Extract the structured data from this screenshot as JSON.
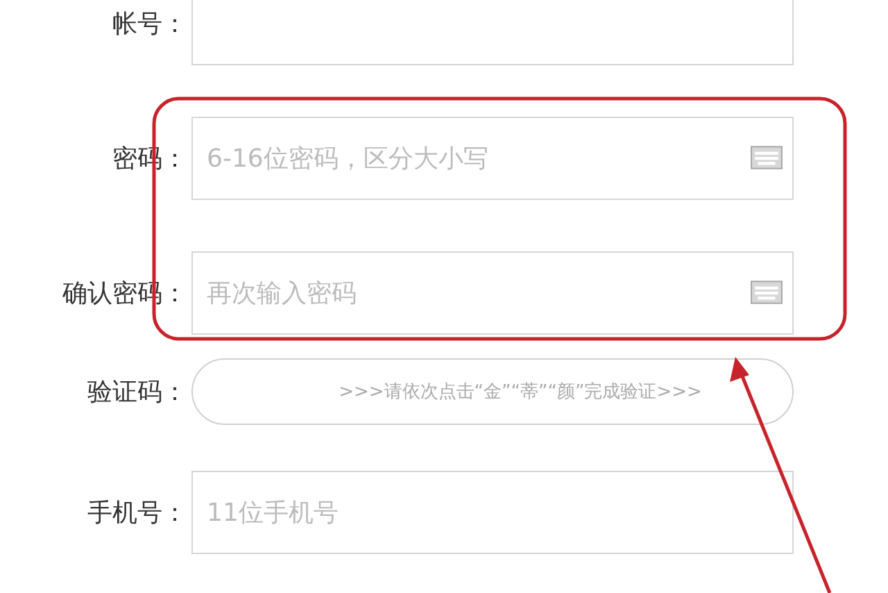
{
  "form": {
    "rows": [
      {
        "kind": "text",
        "label": "帐号：",
        "placeholder": ""
      },
      {
        "kind": "password",
        "label": "密码：",
        "placeholder": "6-16位密码，区分大小写"
      },
      {
        "kind": "password",
        "label": "确认密码：",
        "placeholder": "再次输入密码"
      },
      {
        "kind": "captcha",
        "label": "验证码：",
        "prompt": ">>>请依次点击“金”“蒂”“颜”完成验证>>>"
      },
      {
        "kind": "text",
        "label": "手机号：",
        "placeholder": "11位手机号"
      }
    ]
  }
}
